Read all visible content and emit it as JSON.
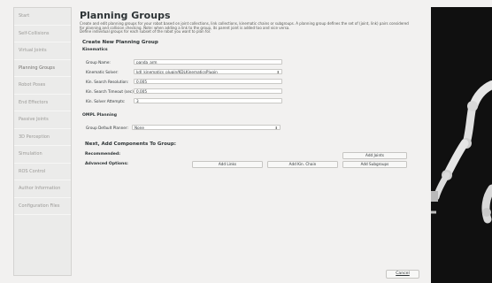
{
  "sidebar": {
    "items": [
      {
        "label": "Start"
      },
      {
        "label": "Self-Collisions"
      },
      {
        "label": "Virtual Joints"
      },
      {
        "label": "Planning Groups"
      },
      {
        "label": "Robot Poses"
      },
      {
        "label": "End Effectors"
      },
      {
        "label": "Passive Joints"
      },
      {
        "label": "3D Perception"
      },
      {
        "label": "Simulation"
      },
      {
        "label": "ROS Control"
      },
      {
        "label": "Author Information"
      },
      {
        "label": "Configuration Files"
      }
    ]
  },
  "main": {
    "title": "Planning Groups",
    "description_lines": [
      "Create and edit planning groups for your robot based on joint collections, link collections, kinematic chains or subgroups. A planning group defines the set of (joint, link) pairs considered",
      "for planning and collision checking. Note: when adding a link to the group, its parent joint is added too and vice versa.",
      "Define individual groups for each subset of the robot you want to plan for."
    ],
    "create_heading": "Create New Planning Group",
    "kinematics_heading": "Kinematics",
    "group_name_label": "Group Name:",
    "group_name_value": "panda_arm",
    "kinematic_solver_label": "Kinematic Solver:",
    "kinematic_solver_value": "kdl_kinematics_plugin/KDLKinematicsPlugin",
    "kin_search_resolution_label": "Kin. Search Resolution:",
    "kin_search_resolution_value": "0.005",
    "kin_search_timeout_label": "Kin. Search Timeout (sec):",
    "kin_search_timeout_value": "0.005",
    "kin_solver_attempts_label": "Kin. Solver Attempts:",
    "kin_solver_attempts_value": "3",
    "ompl_heading": "OMPL Planning",
    "group_default_planner_label": "Group Default Planner:",
    "group_default_planner_value": "None",
    "next_heading": "Next, Add Components To Group:",
    "recommended_label": "Recommended:",
    "advanced_label": "Advanced Options:",
    "add_joints_label": "Add Joints",
    "add_links_label": "Add Links",
    "add_kin_chain_label": "Add Kin. Chain",
    "add_subgroups_label": "Add Subgroups",
    "cancel_label": "Cancel"
  },
  "colors": {
    "window_bg": "#f2f1f0",
    "viewer_bg": "#101010",
    "robot_white": "#e6e6e6",
    "robot_joint": "#b8b8b8"
  }
}
